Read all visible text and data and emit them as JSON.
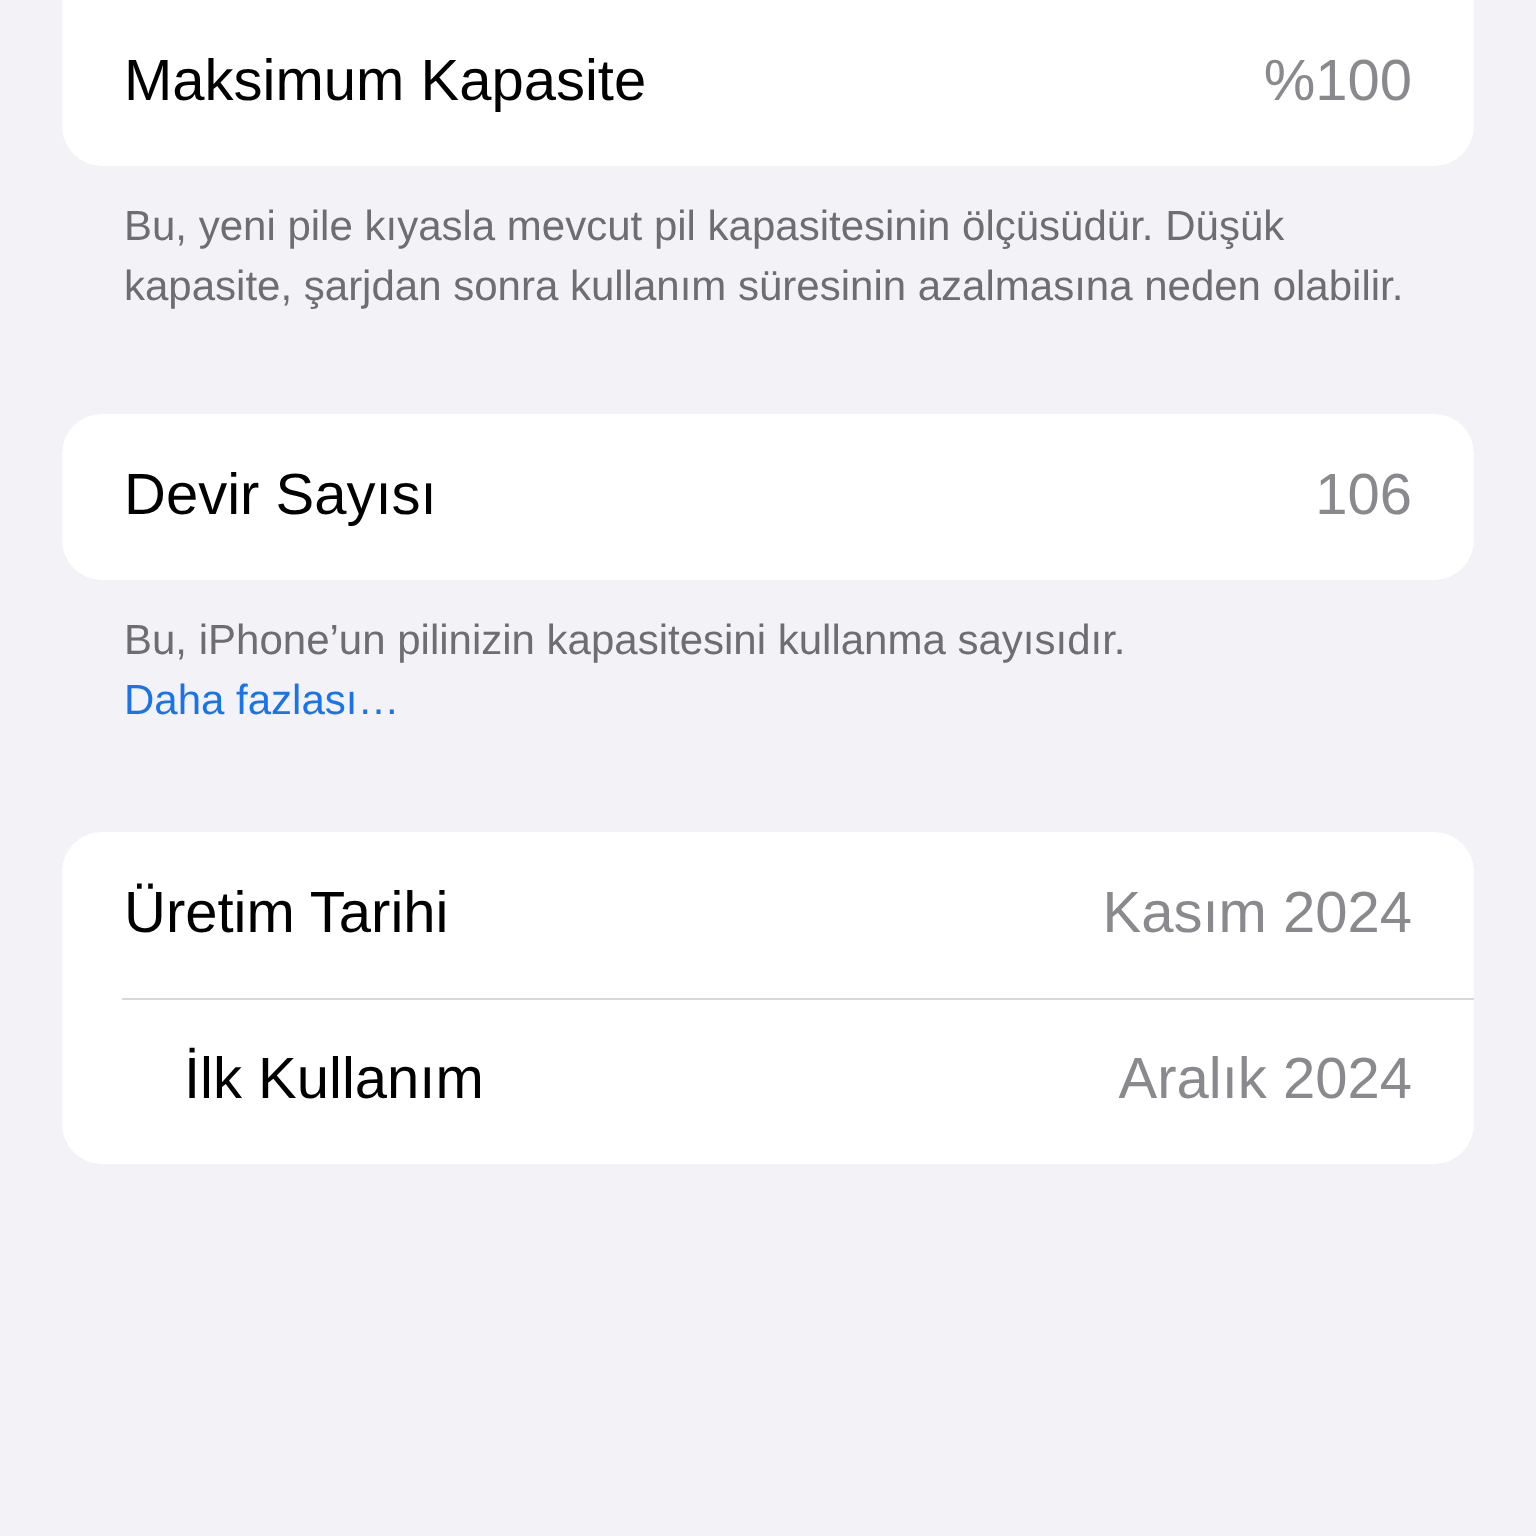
{
  "sections": [
    {
      "rows": [
        {
          "label": "Maksimum Kapasite",
          "value": "%100"
        }
      ],
      "footer": {
        "text": "Bu, yeni pile kıyasla mevcut pil kapasitesinin ölçüsüdür. Düşük kapasite, şarjdan sonra kullanım süresinin azalmasına neden olabilir."
      }
    },
    {
      "rows": [
        {
          "label": "Devir Sayısı",
          "value": "106"
        }
      ],
      "footer": {
        "text": "Bu, iPhone’un pilinizin kapasitesini kullanma sayısıdır.",
        "link": "Daha fazlası…"
      }
    },
    {
      "rows": [
        {
          "label": "Üretim Tarihi",
          "value": "Kasım 2024"
        },
        {
          "label": "İlk Kullanım",
          "value": "Aralık 2024"
        }
      ]
    }
  ]
}
